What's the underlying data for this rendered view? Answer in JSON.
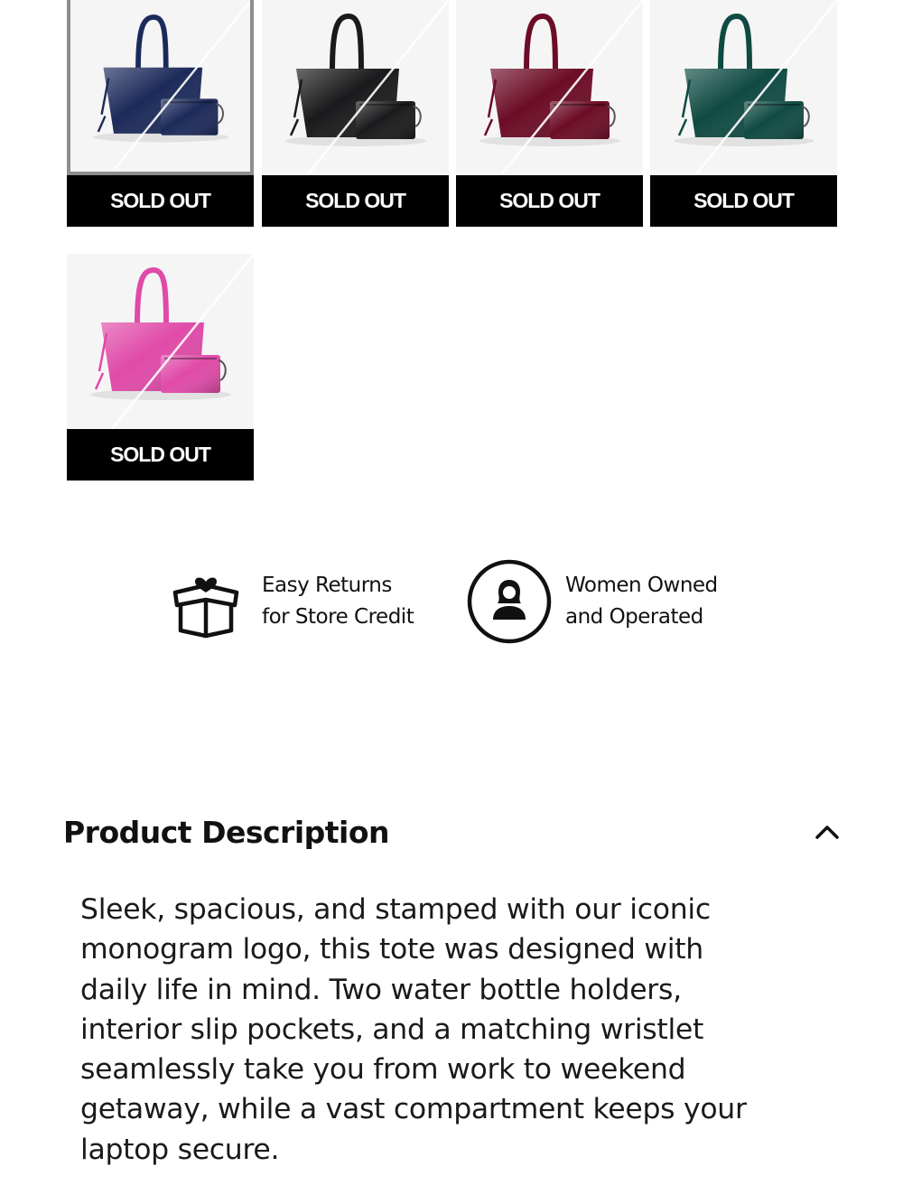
{
  "variants": [
    {
      "color_name": "navy",
      "color": "#1c2a5a",
      "status": "SOLD OUT",
      "selected": true
    },
    {
      "color_name": "black",
      "color": "#1a1a1c",
      "status": "SOLD OUT",
      "selected": false
    },
    {
      "color_name": "burgundy",
      "color": "#6c0c26",
      "status": "SOLD OUT",
      "selected": false
    },
    {
      "color_name": "green",
      "color": "#0f4a42",
      "status": "SOLD OUT",
      "selected": false
    },
    {
      "color_name": "pink",
      "color": "#e04aa8",
      "status": "SOLD OUT",
      "selected": false
    }
  ],
  "badges": {
    "returns": {
      "line1": "Easy Returns",
      "line2": "for Store Credit",
      "icon": "gift-box-heart-icon"
    },
    "women_owned": {
      "line1": "Women Owned",
      "line2": "and Operated",
      "icon": "woman-circle-icon"
    }
  },
  "description": {
    "title": "Product Description",
    "expanded": true,
    "lines": [
      "Sleek, spacious, and stamped with our iconic",
      "monogram logo, this tote was designed with",
      "daily life in mind. Two water bottle holders,",
      "interior slip pockets, and a matching wristlet",
      "seamlessly take you from work to weekend",
      "getaway, while a vast compartment keeps your",
      "laptop secure."
    ]
  }
}
